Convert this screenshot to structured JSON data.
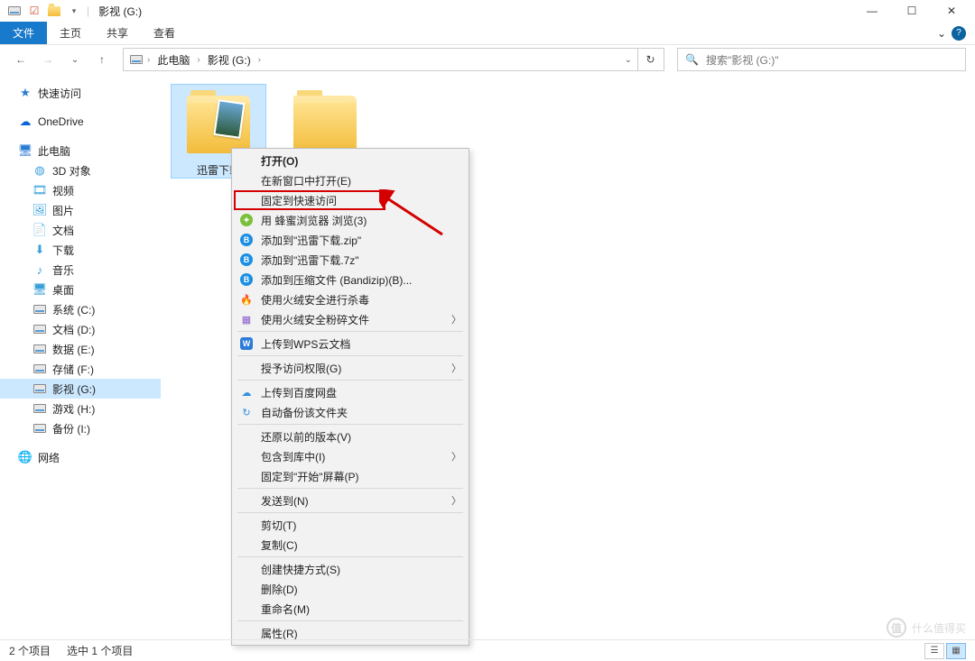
{
  "window": {
    "title": "影视 (G:)",
    "minimize": "—",
    "maximize": "☐",
    "close": "✕"
  },
  "ribbon": {
    "file": "文件",
    "home": "主页",
    "share": "共享",
    "view": "查看",
    "expand": "⌄",
    "help": "?"
  },
  "nav": {
    "back": "←",
    "forward": "→",
    "up": "↑",
    "dropdown": "⌄",
    "refresh": "↻",
    "search_placeholder": "搜索\"影视 (G:)\""
  },
  "breadcrumb": {
    "pc": "此电脑",
    "drive": "影视 (G:)"
  },
  "sidebar": {
    "quick": "快速访问",
    "onedrive": "OneDrive",
    "thispc": "此电脑",
    "objects3d": "3D 对象",
    "videos": "视频",
    "pictures": "图片",
    "documents": "文档",
    "downloads": "下载",
    "music": "音乐",
    "desktop": "桌面",
    "sysC": "系统 (C:)",
    "docD": "文档 (D:)",
    "dataE": "数据 (E:)",
    "storeF": "存储 (F:)",
    "mediaG": "影视 (G:)",
    "gameH": "游戏 (H:)",
    "backupI": "备份 (I:)",
    "network": "网络"
  },
  "folders": {
    "selected": "迅雷下载",
    "other": ""
  },
  "context": {
    "open": "打开(O)",
    "open_new": "在新窗口中打开(E)",
    "pin_quick": "固定到快速访问",
    "browser": "用 蜂蜜浏览器 浏览(3)",
    "addzip": "添加到\"迅雷下载.zip\"",
    "add7z": "添加到\"迅雷下载.7z\"",
    "bandizip": "添加到压缩文件 (Bandizip)(B)...",
    "huorong_scan": "使用火绒安全进行杀毒",
    "huorong_shred": "使用火绒安全粉碎文件",
    "wps": "上传到WPS云文档",
    "grant": "授予访问权限(G)",
    "baidu": "上传到百度网盘",
    "autobk": "自动备份该文件夹",
    "restore": "还原以前的版本(V)",
    "include": "包含到库中(I)",
    "pin_start": "固定到\"开始\"屏幕(P)",
    "sendto": "发送到(N)",
    "cut": "剪切(T)",
    "copy": "复制(C)",
    "shortcut": "创建快捷方式(S)",
    "delete": "删除(D)",
    "rename": "重命名(M)",
    "props": "属性(R)"
  },
  "status": {
    "count": "2 个项目",
    "selected": "选中 1 个项目"
  },
  "watermark": {
    "badge": "值",
    "text": "什么值得买"
  }
}
